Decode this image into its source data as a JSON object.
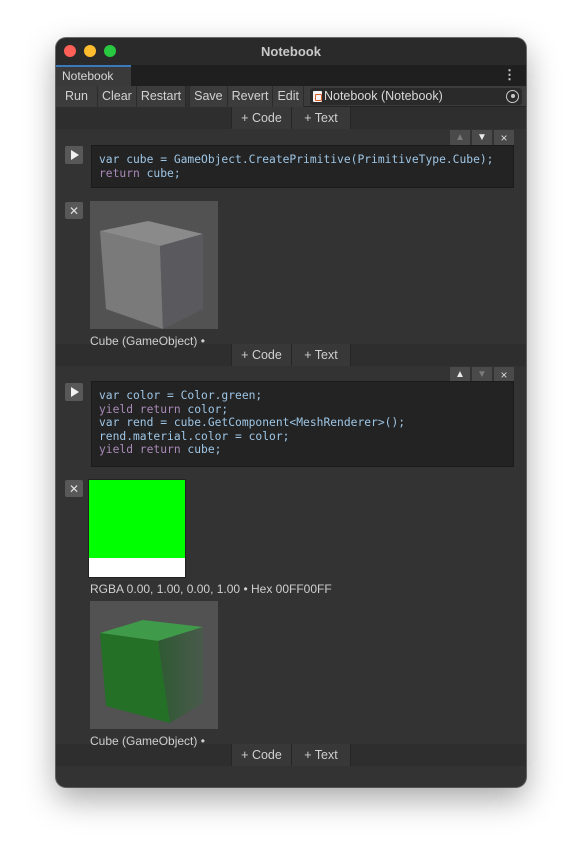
{
  "window": {
    "title": "Notebook",
    "traffic_lights": [
      "close",
      "minimize",
      "zoom"
    ]
  },
  "tabs": [
    {
      "label": "Notebook",
      "active": true
    }
  ],
  "tab_menu_icon": "kebab-menu-icon",
  "toolbar": {
    "run_label": "Run",
    "clear_label": "Clear",
    "restart_label": "Restart",
    "save_label": "Save",
    "revert_label": "Revert",
    "edit_label": "Edit",
    "asset_field": {
      "icon": "notebook-asset-icon",
      "value": "Notebook (Notebook)"
    },
    "target_icon": "object-picker-icon"
  },
  "add_bar": {
    "code_label": "+ Code",
    "text_label": "+ Text"
  },
  "cells": [
    {
      "type": "code",
      "controls": {
        "move_up_enabled": false,
        "move_down_enabled": true,
        "close": "×"
      },
      "lines": [
        "var cube = GameObject.CreatePrimitive(PrimitiveType.Cube);",
        "return cube;"
      ],
      "outputs": [
        {
          "type": "object-preview",
          "preview_color": "gray",
          "caption": "Cube (GameObject) •"
        }
      ]
    },
    {
      "type": "code",
      "controls": {
        "move_up_enabled": true,
        "move_down_enabled": false,
        "close": "×"
      },
      "lines": [
        "var color = Color.green;",
        "yield return color;",
        "var rend = cube.GetComponent<MeshRenderer>();",
        "rend.material.color = color;",
        "yield return cube;"
      ],
      "outputs": [
        {
          "type": "color-swatch",
          "color": "#00FF00",
          "caption": "RGBA 0.00, 1.00, 0.00, 1.00 • Hex 00FF00FF"
        },
        {
          "type": "object-preview",
          "preview_color": "green",
          "caption": "Cube (GameObject) •"
        }
      ]
    }
  ],
  "colors": {
    "accent_tab": "#3A79BB",
    "code_text": "#9EC6E6",
    "code_keyword": "#C586C0",
    "swatch_green": "#00FF00"
  }
}
